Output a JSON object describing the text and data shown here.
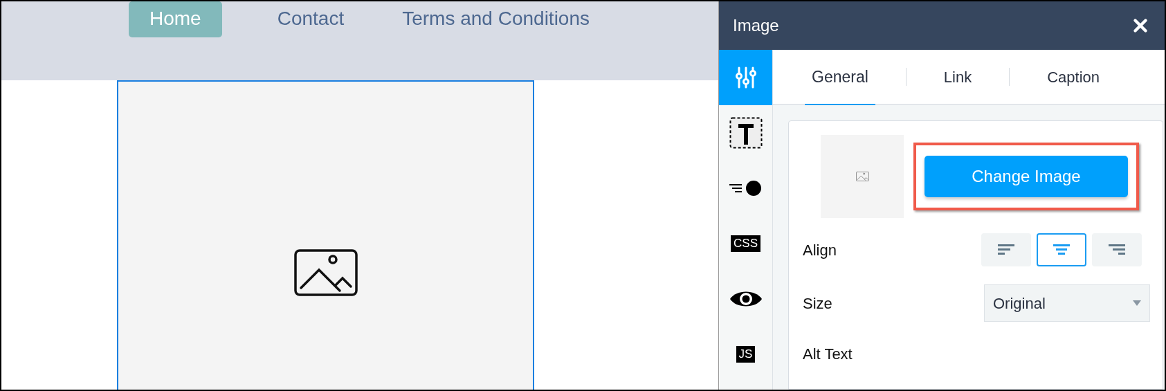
{
  "nav": {
    "items": [
      {
        "label": "Home",
        "selected": true
      },
      {
        "label": "Contact",
        "selected": false
      },
      {
        "label": "Terms and Conditions",
        "selected": false
      }
    ]
  },
  "panel": {
    "title": "Image",
    "side_tools": [
      {
        "kind": "settings",
        "selected": true
      },
      {
        "kind": "text",
        "selected": false
      },
      {
        "kind": "animation",
        "selected": false
      },
      {
        "kind": "badge",
        "label": "CSS",
        "selected": false
      },
      {
        "kind": "visibility",
        "selected": false
      },
      {
        "kind": "badge",
        "label": "JS",
        "selected": false
      }
    ],
    "tabs": [
      {
        "label": "General",
        "selected": true
      },
      {
        "label": "Link",
        "selected": false
      },
      {
        "label": "Caption",
        "selected": false
      }
    ],
    "change_image": {
      "label": "Change Image",
      "highlighted": true
    },
    "align": {
      "label": "Align",
      "options": [
        {
          "kind": "left",
          "selected": false
        },
        {
          "kind": "center",
          "selected": true
        },
        {
          "kind": "right",
          "selected": false
        }
      ]
    },
    "size": {
      "label": "Size",
      "value": "Original"
    },
    "alt_text": {
      "label": "Alt Text"
    }
  }
}
